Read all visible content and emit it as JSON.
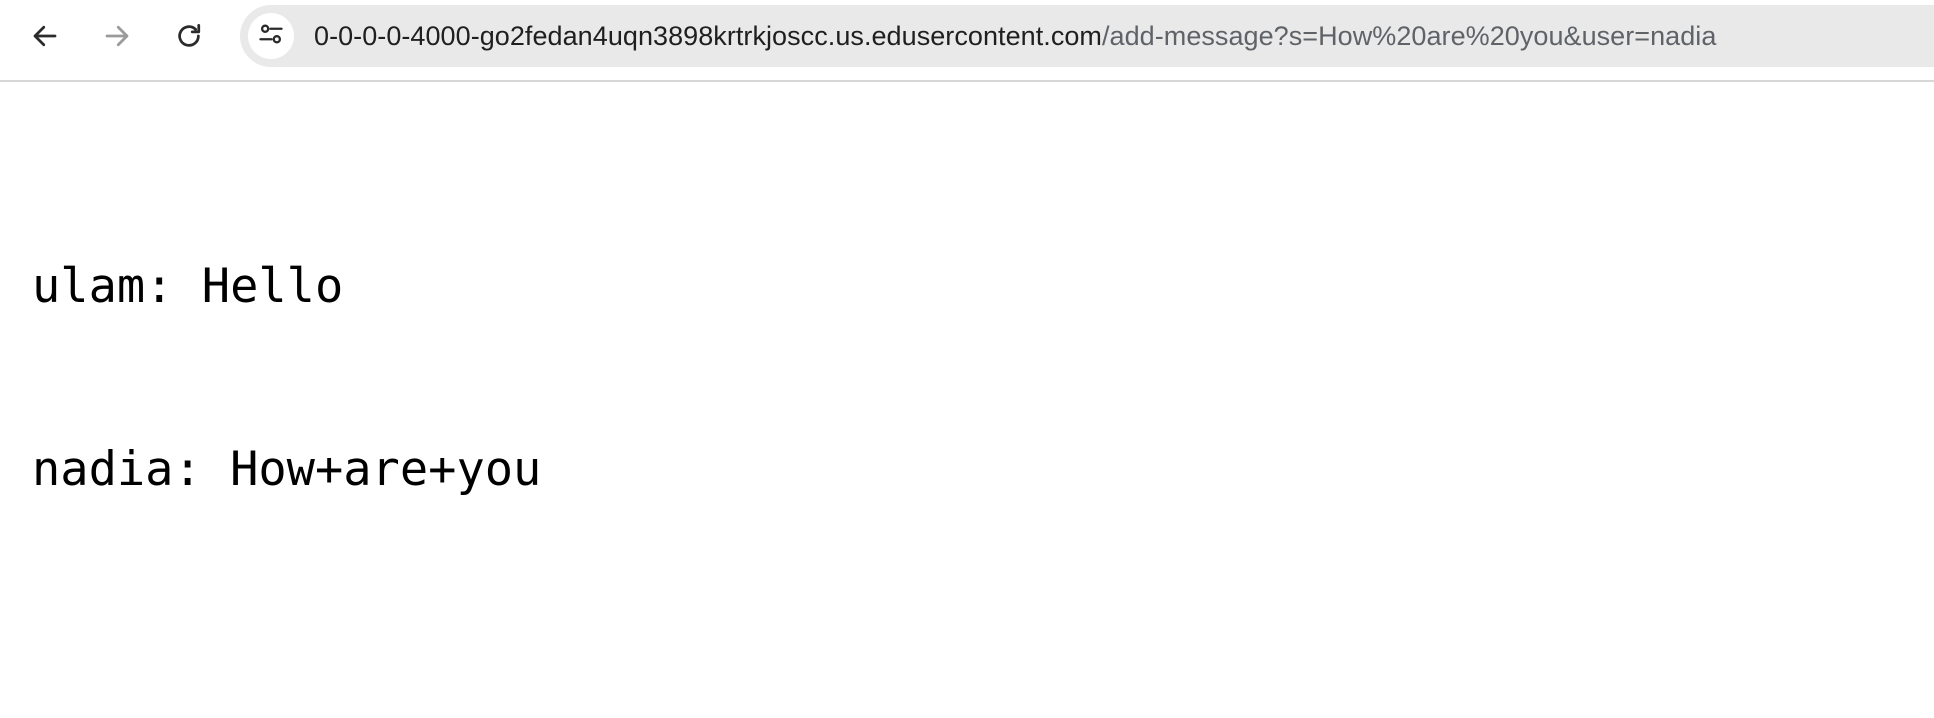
{
  "toolbar": {
    "back_icon": "arrow-left-icon",
    "forward_icon": "arrow-right-icon",
    "reload_icon": "reload-icon",
    "site_info_icon": "tune-sliders-icon"
  },
  "address_bar": {
    "host": "0-0-0-0-4000-go2fedan4uqn3898krtrkjoscc.us.edusercontent.com",
    "path": "/add-message?s=How%20are%20you&user=nadia"
  },
  "messages": [
    {
      "text": "ulam: Hello"
    },
    {
      "text": "nadia: How+are+you"
    }
  ],
  "colors": {
    "omnibox_bg": "#e9e9e9",
    "host_text": "#1f1f1f",
    "path_text": "#5f6368",
    "forward_disabled": "#9a9a9a"
  }
}
